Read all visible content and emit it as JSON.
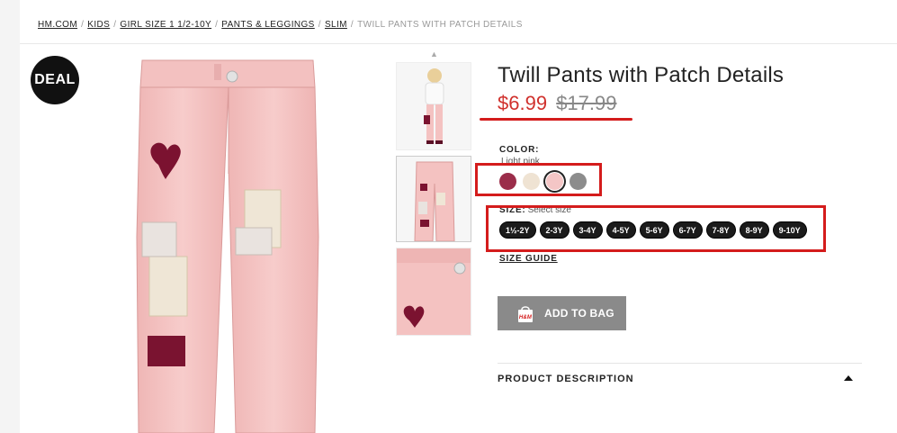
{
  "breadcrumb": {
    "items": [
      "HM.COM",
      "KIDS",
      "GIRL SIZE 1 1/2-10Y",
      "PANTS & LEGGINGS",
      "SLIM"
    ],
    "current": "TWILL PANTS WITH PATCH DETAILS",
    "separator": "/"
  },
  "badge": {
    "deal": "DEAL"
  },
  "product": {
    "title": "Twill Pants with Patch Details",
    "price_sale": "$6.99",
    "price_original": "$17.99"
  },
  "color": {
    "label": "COLOR:",
    "selected_name": "Light pink",
    "swatches": [
      "#9b2d4a",
      "#efe3d3",
      "#f4c6c6",
      "#8c8c8c"
    ],
    "selected_index": 2
  },
  "size": {
    "label": "SIZE:",
    "hint": "Select size",
    "options": [
      "1½-2Y",
      "2-3Y",
      "3-4Y",
      "4-5Y",
      "5-6Y",
      "6-7Y",
      "7-8Y",
      "8-9Y",
      "9-10Y"
    ]
  },
  "size_guide": "SIZE GUIDE",
  "add_to_bag": {
    "label": "ADD TO BAG",
    "icon": "shopping-bag-icon",
    "icon_text": "H&M"
  },
  "description": {
    "title": "PRODUCT DESCRIPTION",
    "toggle_icon": "caret-up-icon"
  },
  "colors": {
    "accent_red": "#d41c1c",
    "sale_red": "#d0312d",
    "button_gray": "#8a8a8a"
  }
}
